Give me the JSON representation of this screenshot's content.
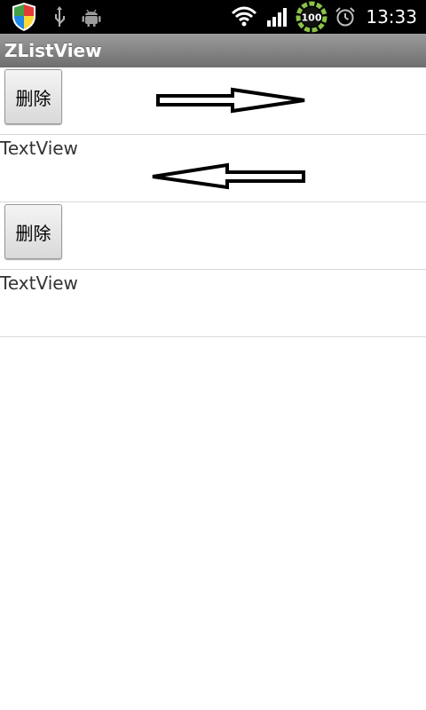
{
  "status_bar": {
    "time": "13:33",
    "battery_level": "100",
    "icons": [
      "shield-icon",
      "usb-icon",
      "android-debug-icon",
      "wifi-icon",
      "signal-icon",
      "battery-icon",
      "alarm-icon"
    ]
  },
  "title_bar": {
    "title": "ZListView"
  },
  "list": {
    "items": [
      {
        "kind": "button",
        "label": "删除",
        "arrow": "right-arrow-icon"
      },
      {
        "kind": "text",
        "label": "TextView",
        "arrow": "left-arrow-icon"
      },
      {
        "kind": "button",
        "label": "删除"
      },
      {
        "kind": "text",
        "label": "TextView"
      }
    ]
  },
  "colors": {
    "status_bar_bg": "#000000",
    "title_bar_bg": "#7f7f7f",
    "divider": "#d9d9d9",
    "text": "#333333"
  }
}
